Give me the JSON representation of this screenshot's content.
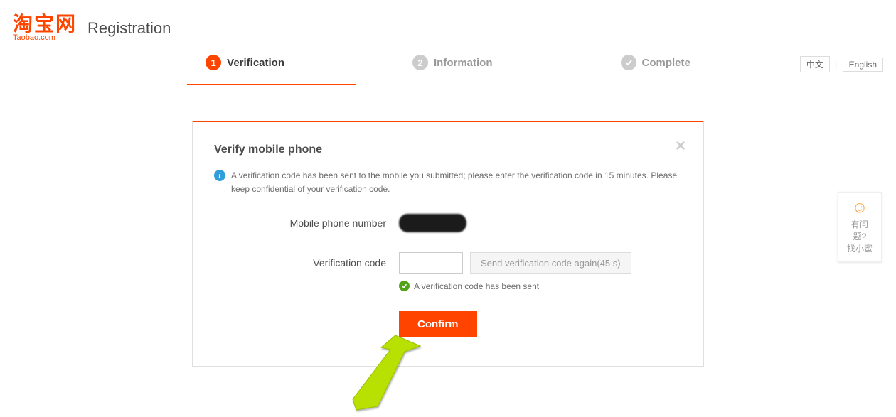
{
  "header": {
    "logo_cn": "淘宝网",
    "logo_en": "Taobao.com",
    "page_title": "Registration"
  },
  "steps": {
    "s1": {
      "num": "1",
      "label": "Verification"
    },
    "s2": {
      "num": "2",
      "label": "Information"
    },
    "s3": {
      "label": "Complete"
    }
  },
  "lang": {
    "zh": "中文",
    "en": "English"
  },
  "card": {
    "title": "Verify mobile phone",
    "info": "A verification code has been sent to the mobile you submitted; please enter the verification code in 15 minutes. Please keep confidential of your verification code.",
    "label_phone": "Mobile phone number",
    "label_code": "Verification code",
    "resend": "Send verification code again(45 s)",
    "sent_msg": "A verification code has been sent",
    "confirm": "Confirm"
  },
  "helper": {
    "line1": "有问题?",
    "line2": "找小蜜"
  }
}
